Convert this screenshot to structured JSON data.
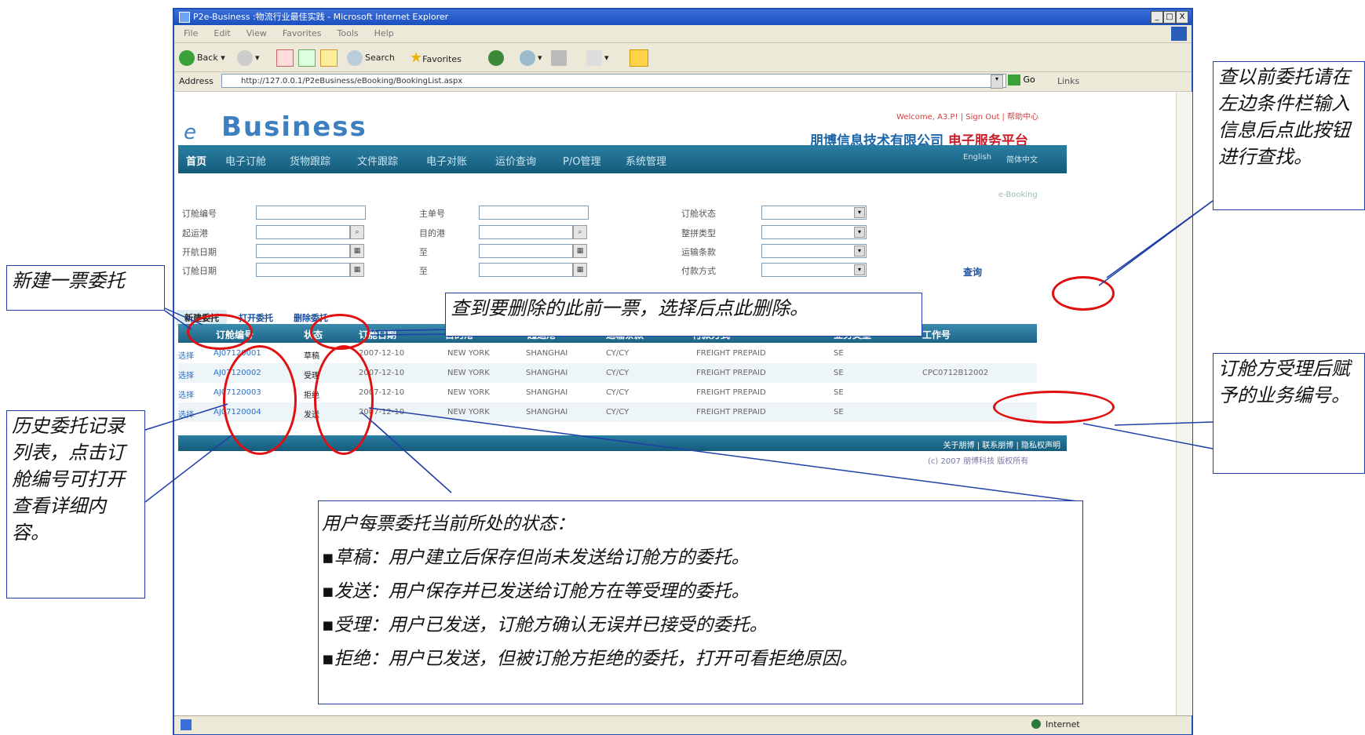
{
  "window": {
    "title": "P2e-Business :物流行业最佳实践 - Microsoft Internet Explorer",
    "controls": [
      "_",
      "□",
      "X"
    ]
  },
  "menu": [
    "File",
    "Edit",
    "View",
    "Favorites",
    "Tools",
    "Help"
  ],
  "toolbar": {
    "back": "Back",
    "search": "Search",
    "favorites": "Favorites"
  },
  "address": {
    "label": "Address",
    "url": "http://127.0.0.1/P2eBusiness/eBooking/BookingList.aspx",
    "go": "Go",
    "links": "Links"
  },
  "header": {
    "welcome": "Welcome, A3.P! | Sign Out | 帮助中心",
    "logo": "Business",
    "logo_e": "e",
    "company": "朋博信息技术有限公司",
    "platform": "电子服务平台"
  },
  "nav": {
    "items": [
      "首页",
      "电子订舱",
      "货物跟踪",
      "文件跟踪",
      "电子对账",
      "运价查询",
      "P/O管理",
      "系统管理"
    ],
    "lang_en": "English",
    "lang_cn": "简体中文"
  },
  "breadcrumb": "e-Booking",
  "filters": {
    "col1": [
      "订舱编号",
      "起运港",
      "开航日期",
      "订舱日期"
    ],
    "col2": [
      "主单号",
      "目的港",
      "至",
      "至"
    ],
    "col3": [
      "订舱状态",
      "整拼类型",
      "运输条款",
      "付款方式"
    ],
    "query_button": "查询"
  },
  "actions": {
    "new": "新建委托",
    "open": "打开委托",
    "delete": "删除委托"
  },
  "table": {
    "headers": [
      "订舱编号",
      "状态",
      "订舱日期",
      "目的港",
      "起运港",
      "运输条款",
      "付款方式",
      "业务类型",
      "工作号"
    ],
    "select_label": "选择",
    "rows": [
      {
        "no": "AJ07120001",
        "status": "草稿",
        "date": "2007-12-10",
        "dest": "NEW YORK",
        "origin": "SHANGHAI",
        "terms": "CY/CY",
        "payment": "FREIGHT PREPAID",
        "type": "SE",
        "job": ""
      },
      {
        "no": "AJ07120002",
        "status": "受理",
        "date": "2007-12-10",
        "dest": "NEW YORK",
        "origin": "SHANGHAI",
        "terms": "CY/CY",
        "payment": "FREIGHT PREPAID",
        "type": "SE",
        "job": "CPC0712B12002"
      },
      {
        "no": "AJ07120003",
        "status": "拒绝",
        "date": "2007-12-10",
        "dest": "NEW YORK",
        "origin": "SHANGHAI",
        "terms": "CY/CY",
        "payment": "FREIGHT PREPAID",
        "type": "SE",
        "job": ""
      },
      {
        "no": "AJ07120004",
        "status": "发送",
        "date": "2007-12-10",
        "dest": "NEW YORK",
        "origin": "SHANGHAI",
        "terms": "CY/CY",
        "payment": "FREIGHT PREPAID",
        "type": "SE",
        "job": ""
      }
    ]
  },
  "footer": {
    "links": "关于朋博 | 联系朋博 | 隐私权声明",
    "copyright": "(c) 2007 朋博科技 版权所有"
  },
  "status_bar": {
    "zone": "Internet"
  },
  "annotations": {
    "query": "查以前委托请在左边条件栏输入信息后点此按钮进行查找。",
    "new": "新建一票委托",
    "delete": "查到要删除的此前一票，选择后点此删除。",
    "job": "订舱方受理后赋予的业务编号。",
    "history": "历史委托记录列表，点击订舱编号可打开查看详细内容。",
    "status_title": "用户每票委托当前所处的状态：",
    "status_items": [
      "草稿：用户建立后保存但尚未发送给订舱方的委托。",
      "发送：用户保存并已发送给订舱方在等受理的委托。",
      "受理：用户已发送，订舱方确认无误并已接受的委托。",
      "拒绝：用户已发送，但被订舱方拒绝的委托，打开可看拒绝原因。"
    ]
  },
  "colors": {
    "annotation_border": "#1f3fa8",
    "highlight": "#e01010",
    "nav": "#1b6a8c"
  }
}
